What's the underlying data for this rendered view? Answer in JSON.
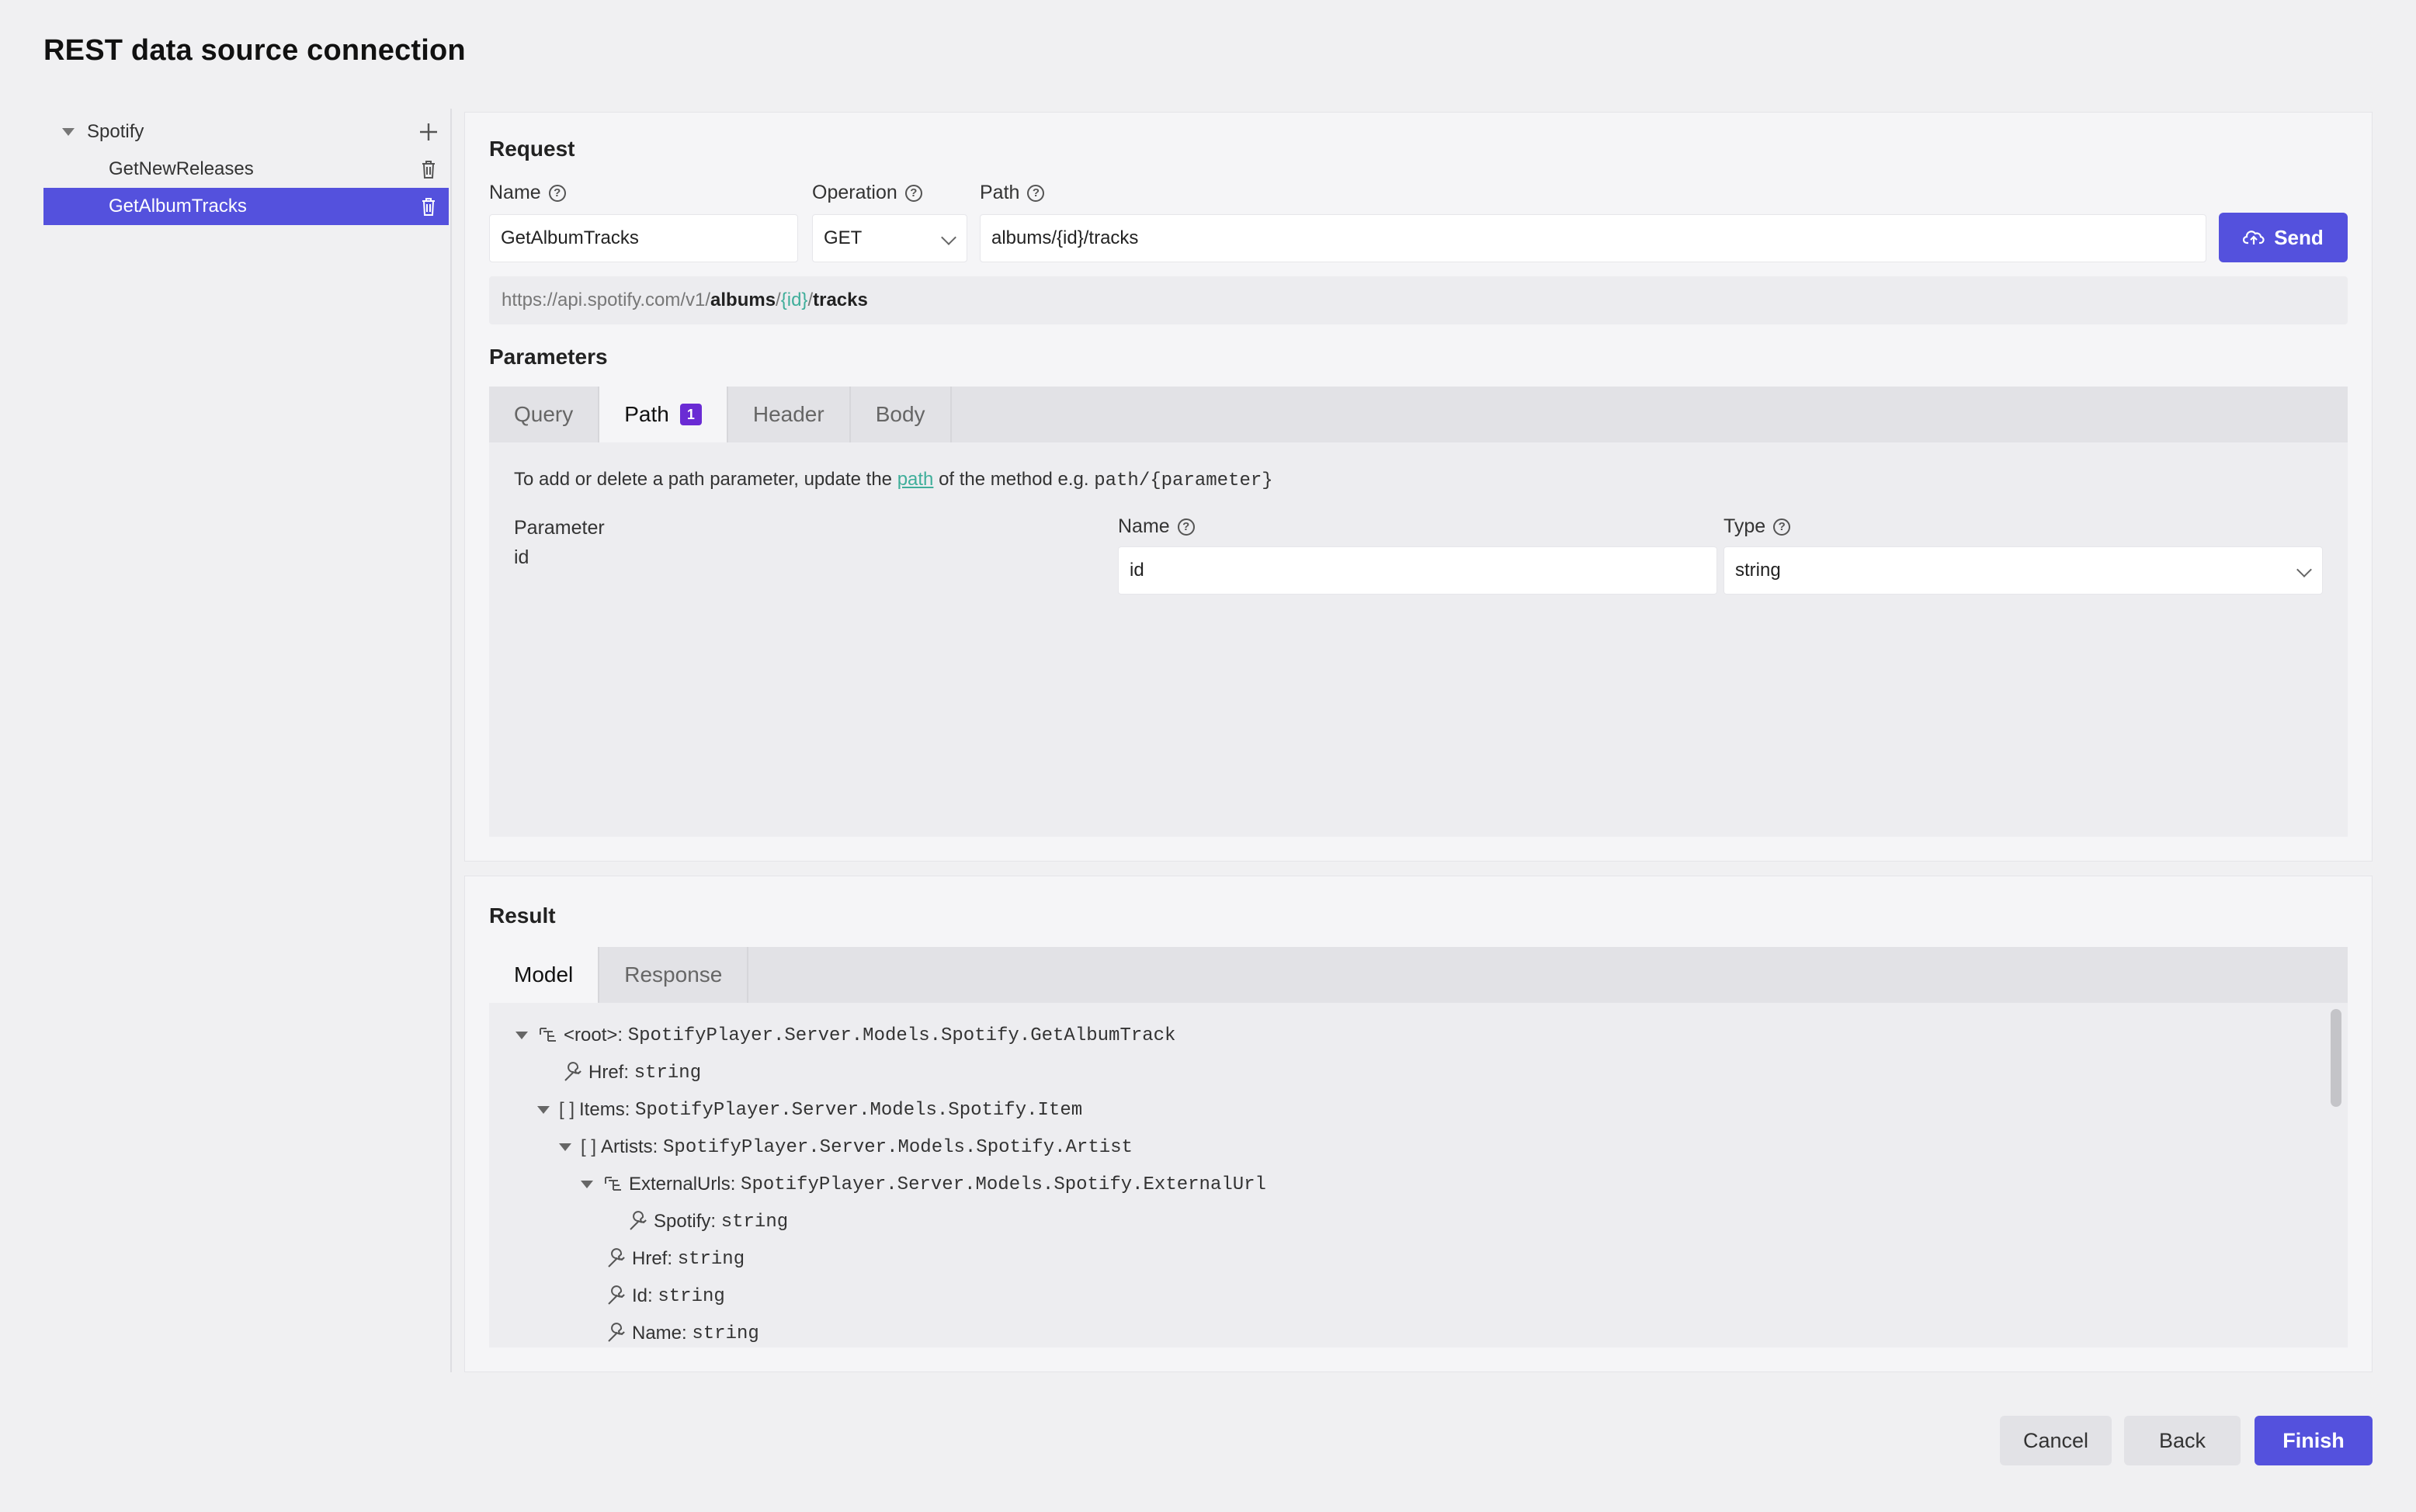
{
  "dialog": {
    "title": "REST data source connection"
  },
  "tree": {
    "root": "Spotify",
    "items": [
      {
        "label": "GetNewReleases",
        "selected": false
      },
      {
        "label": "GetAlbumTracks",
        "selected": true
      }
    ]
  },
  "request": {
    "section_title": "Request",
    "name_label": "Name",
    "name_value": "GetAlbumTracks",
    "operation_label": "Operation",
    "operation_value": "GET",
    "path_label": "Path",
    "path_value": "albums/{id}/tracks",
    "send_label": "Send",
    "url_base": "https://api.spotify.com/v1/",
    "url_seg1": "albums",
    "url_slash1": "/",
    "url_param": "{id}",
    "url_slash2": "/",
    "url_seg2": "tracks"
  },
  "parameters": {
    "section_title": "Parameters",
    "tabs": [
      {
        "label": "Query"
      },
      {
        "label": "Path",
        "badge": "1"
      },
      {
        "label": "Header"
      },
      {
        "label": "Body"
      }
    ],
    "hint_prefix": "To add or delete a path parameter, update the ",
    "hint_link": "path",
    "hint_middle": " of the method e.g. ",
    "hint_code": "path/{parameter}",
    "param_col_label": "Parameter",
    "param_value": "id",
    "name_label": "Name",
    "name_value": "id",
    "type_label": "Type",
    "type_value": "string"
  },
  "result": {
    "section_title": "Result",
    "tabs": [
      {
        "label": "Model"
      },
      {
        "label": "Response"
      }
    ],
    "model_rows": [
      {
        "label": "<root>:",
        "type": "SpotifyPlayer.Server.Models.Spotify.GetAlbumTrack"
      },
      {
        "label": "Href:",
        "type": "string"
      },
      {
        "label": "Items:",
        "type": "SpotifyPlayer.Server.Models.Spotify.Item"
      },
      {
        "label": "Artists:",
        "type": "SpotifyPlayer.Server.Models.Spotify.Artist"
      },
      {
        "label": "ExternalUrls:",
        "type": "SpotifyPlayer.Server.Models.Spotify.ExternalUrl"
      },
      {
        "label": "Spotify:",
        "type": "string"
      },
      {
        "label": "Href:",
        "type": "string"
      },
      {
        "label": "Id:",
        "type": "string"
      },
      {
        "label": "Name:",
        "type": "string"
      }
    ],
    "brackets": "[ ]"
  },
  "footer": {
    "cancel_label": "Cancel",
    "back_label": "Back",
    "finish_label": "Finish"
  },
  "colors": {
    "accent": "#5451dd",
    "param": "#3fae9a",
    "badge": "#6a2bd4"
  }
}
